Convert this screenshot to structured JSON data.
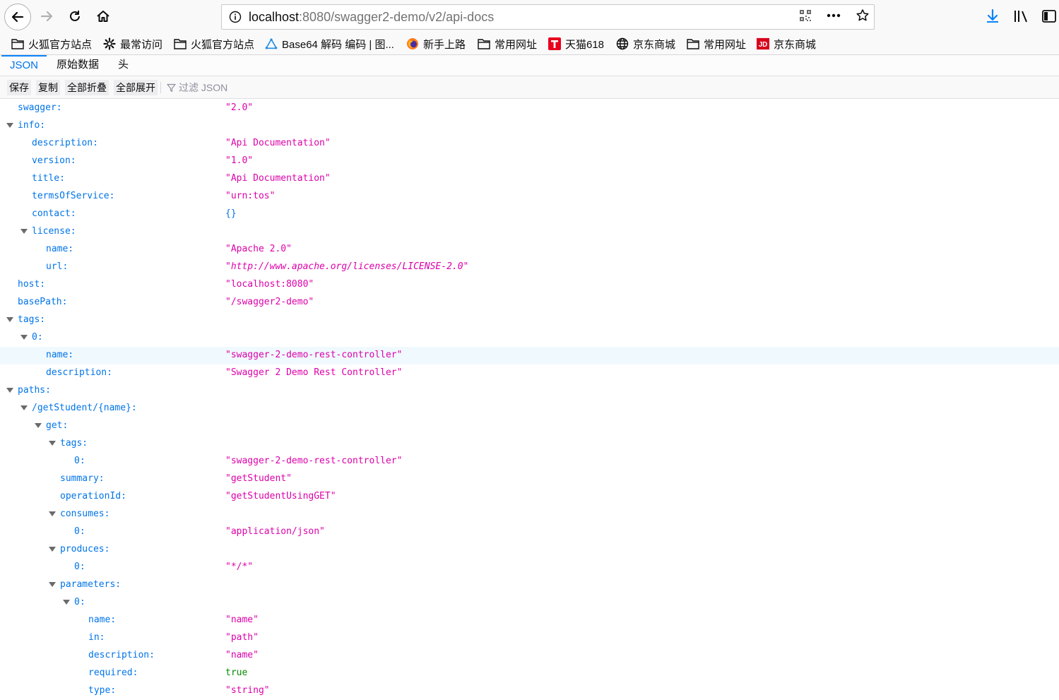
{
  "browser": {
    "url_host": "localhost",
    "url_rest": ":8080/swagger2-demo/v2/api-docs"
  },
  "bookmarks": [
    {
      "label": "火狐官方站点",
      "icon": "folder-icon"
    },
    {
      "label": "最常访问",
      "icon": "gear-icon"
    },
    {
      "label": "火狐官方站点",
      "icon": "folder-icon"
    },
    {
      "label": "Base64 解码 编码 | 图...",
      "icon": "triangle-logo-icon"
    },
    {
      "label": "新手上路",
      "icon": "firefox-icon"
    },
    {
      "label": "常用网址",
      "icon": "folder-icon"
    },
    {
      "label": "天猫618",
      "icon": "tmall-icon"
    },
    {
      "label": "京东商城",
      "icon": "globe-icon"
    },
    {
      "label": "常用网址",
      "icon": "folder-icon"
    },
    {
      "label": "京东商城",
      "icon": "jd-icon"
    }
  ],
  "tabs": [
    {
      "label": "JSON",
      "selected": true
    },
    {
      "label": "原始数据",
      "selected": false
    },
    {
      "label": "头",
      "selected": false
    }
  ],
  "toolbar": {
    "save": "保存",
    "copy": "复制",
    "collapse_all": "全部折叠",
    "expand_all": "全部展开",
    "filter_placeholder": "过滤 JSON"
  },
  "tree": [
    {
      "depth": 0,
      "key": "swagger:",
      "value": "\"2.0\"",
      "type": "string"
    },
    {
      "depth": 0,
      "key": "info:",
      "expandable": true
    },
    {
      "depth": 1,
      "key": "description:",
      "value": "\"Api Documentation\"",
      "type": "string"
    },
    {
      "depth": 1,
      "key": "version:",
      "value": "\"1.0\"",
      "type": "string"
    },
    {
      "depth": 1,
      "key": "title:",
      "value": "\"Api Documentation\"",
      "type": "string"
    },
    {
      "depth": 1,
      "key": "termsOfService:",
      "value": "\"urn:tos\"",
      "type": "string"
    },
    {
      "depth": 1,
      "key": "contact:",
      "value": "{}",
      "type": "obj"
    },
    {
      "depth": 1,
      "key": "license:",
      "expandable": true
    },
    {
      "depth": 2,
      "key": "name:",
      "value": "\"Apache 2.0\"",
      "type": "string"
    },
    {
      "depth": 2,
      "key": "url:",
      "value": "\"http://www.apache.org/licenses/LICENSE-2.0\"",
      "type": "url"
    },
    {
      "depth": 0,
      "key": "host:",
      "value": "\"localhost:8080\"",
      "type": "string"
    },
    {
      "depth": 0,
      "key": "basePath:",
      "value": "\"/swagger2-demo\"",
      "type": "string"
    },
    {
      "depth": 0,
      "key": "tags:",
      "expandable": true
    },
    {
      "depth": 1,
      "key": "0:",
      "expandable": true
    },
    {
      "depth": 2,
      "key": "name:",
      "value": "\"swagger-2-demo-rest-controller\"",
      "type": "string",
      "highlight": true
    },
    {
      "depth": 2,
      "key": "description:",
      "value": "\"Swagger 2 Demo Rest Controller\"",
      "type": "string"
    },
    {
      "depth": 0,
      "key": "paths:",
      "expandable": true
    },
    {
      "depth": 1,
      "key": "/getStudent/{name}:",
      "expandable": true
    },
    {
      "depth": 2,
      "key": "get:",
      "expandable": true
    },
    {
      "depth": 3,
      "key": "tags:",
      "expandable": true
    },
    {
      "depth": 4,
      "key": "0:",
      "value": "\"swagger-2-demo-rest-controller\"",
      "type": "string"
    },
    {
      "depth": 3,
      "key": "summary:",
      "value": "\"getStudent\"",
      "type": "string"
    },
    {
      "depth": 3,
      "key": "operationId:",
      "value": "\"getStudentUsingGET\"",
      "type": "string"
    },
    {
      "depth": 3,
      "key": "consumes:",
      "expandable": true
    },
    {
      "depth": 4,
      "key": "0:",
      "value": "\"application/json\"",
      "type": "string"
    },
    {
      "depth": 3,
      "key": "produces:",
      "expandable": true
    },
    {
      "depth": 4,
      "key": "0:",
      "value": "\"*/*\"",
      "type": "string"
    },
    {
      "depth": 3,
      "key": "parameters:",
      "expandable": true
    },
    {
      "depth": 4,
      "key": "0:",
      "expandable": true
    },
    {
      "depth": 5,
      "key": "name:",
      "value": "\"name\"",
      "type": "string"
    },
    {
      "depth": 5,
      "key": "in:",
      "value": "\"path\"",
      "type": "string"
    },
    {
      "depth": 5,
      "key": "description:",
      "value": "\"name\"",
      "type": "string"
    },
    {
      "depth": 5,
      "key": "required:",
      "value": "true",
      "type": "bool"
    },
    {
      "depth": 5,
      "key": "type:",
      "value": "\"string\"",
      "type": "string"
    }
  ]
}
